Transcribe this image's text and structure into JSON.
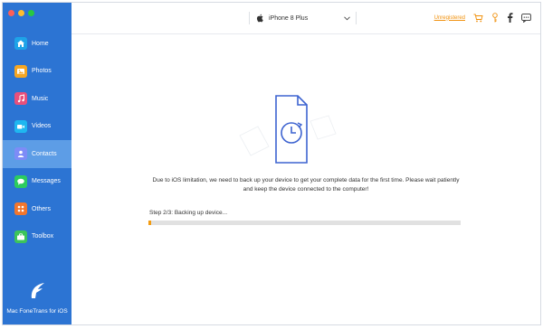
{
  "window": {
    "traffic_colors": [
      "#fd5f57",
      "#febc2e",
      "#28c840"
    ]
  },
  "sidebar": {
    "bg": "#2c74d3",
    "items": [
      {
        "label": "Home",
        "icon": "home-icon",
        "color": "#1ea3e8"
      },
      {
        "label": "Photos",
        "icon": "photo-icon",
        "color": "#f5a623"
      },
      {
        "label": "Music",
        "icon": "music-icon",
        "color": "#e8507c"
      },
      {
        "label": "Videos",
        "icon": "video-icon",
        "color": "#1fb7f0"
      },
      {
        "label": "Contacts",
        "icon": "contact-icon",
        "color": "#7d8cf7",
        "active": true
      },
      {
        "label": "Messages",
        "icon": "message-icon",
        "color": "#2ccb5f"
      },
      {
        "label": "Others",
        "icon": "others-icon",
        "color": "#f2762d"
      },
      {
        "label": "Toolbox",
        "icon": "toolbox-icon",
        "color": "#3cc45b"
      }
    ],
    "brand": {
      "name": "Mac FoneTrans for iOS",
      "icon": "fonetrans-logo-icon"
    }
  },
  "topbar": {
    "device_name": "iPhone 8 Plus",
    "unregistered": "Unregistered",
    "icons": [
      "cart-icon",
      "key-icon",
      "facebook-icon",
      "feedback-icon"
    ]
  },
  "main": {
    "notice": "Due to iOS limitation, we need to back up your device to get your complete data for the first time. Please wait patiently and keep the device connected to the computer!",
    "step": "Step 2/3: Backing up device...",
    "progress": 0.01
  },
  "colors": {
    "accent": "#2c74d3",
    "progress": "#f39c12",
    "unregistered": "#f0900b"
  }
}
